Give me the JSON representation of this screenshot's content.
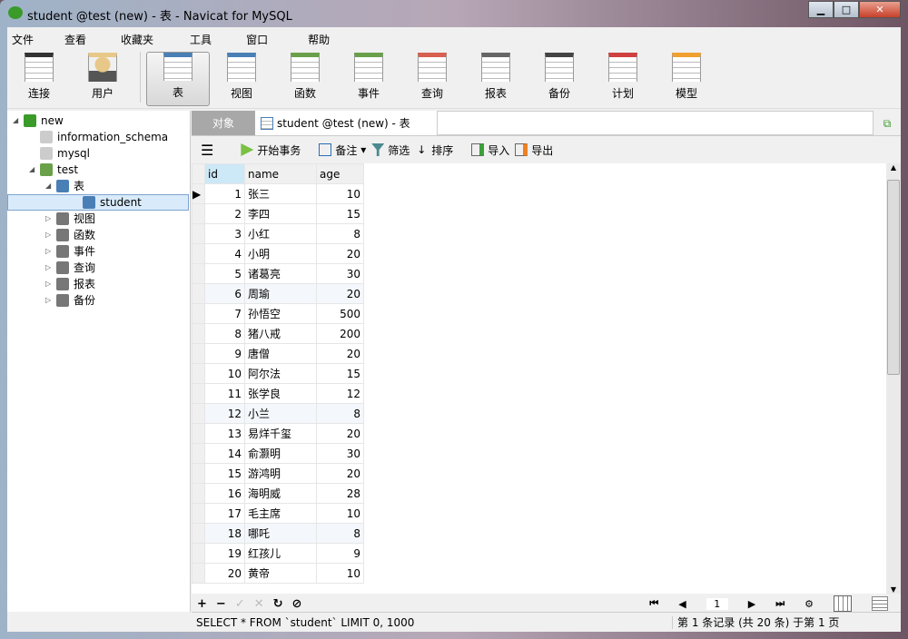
{
  "window": {
    "title": "student @test (new) - 表 - Navicat for MySQL",
    "minimize": "▁",
    "maximize": "□",
    "close": "✕"
  },
  "menu": [
    "文件",
    "查看",
    "收藏夹",
    "工具",
    "窗口",
    "帮助"
  ],
  "toolbar": [
    {
      "label": "连接",
      "icon": "connection-icon"
    },
    {
      "label": "用户",
      "icon": "user-icon"
    },
    {
      "label": "表",
      "icon": "table-icon",
      "active": true
    },
    {
      "label": "视图",
      "icon": "view-icon"
    },
    {
      "label": "函数",
      "icon": "function-icon"
    },
    {
      "label": "事件",
      "icon": "event-icon"
    },
    {
      "label": "查询",
      "icon": "query-icon"
    },
    {
      "label": "报表",
      "icon": "report-icon"
    },
    {
      "label": "备份",
      "icon": "backup-icon"
    },
    {
      "label": "计划",
      "icon": "schedule-icon"
    },
    {
      "label": "模型",
      "icon": "model-icon"
    }
  ],
  "tree": {
    "connection": "new",
    "dbs": [
      "information_schema",
      "mysql",
      "test"
    ],
    "tables_group": "表",
    "table": "student",
    "groups": [
      "视图",
      "函数",
      "事件",
      "查询",
      "报表",
      "备份"
    ]
  },
  "tabs": {
    "objects": "对象",
    "current": "student @test (new) - 表"
  },
  "table_toolbar": {
    "begin_tx": "开始事务",
    "note": "备注",
    "filter": "筛选",
    "sort": "排序",
    "import": "导入",
    "export": "导出"
  },
  "columns": [
    "id",
    "name",
    "age"
  ],
  "rows": [
    [
      1,
      "张三",
      10
    ],
    [
      2,
      "李四",
      15
    ],
    [
      3,
      "小红",
      8
    ],
    [
      4,
      "小明",
      20
    ],
    [
      5,
      "诸葛亮",
      30
    ],
    [
      6,
      "周瑜",
      20
    ],
    [
      7,
      "孙悟空",
      500
    ],
    [
      8,
      "猪八戒",
      200
    ],
    [
      9,
      "唐僧",
      20
    ],
    [
      10,
      "阿尔法",
      15
    ],
    [
      11,
      "张学良",
      12
    ],
    [
      12,
      "小兰",
      8
    ],
    [
      13,
      "易烊千玺",
      20
    ],
    [
      14,
      "俞灏明",
      30
    ],
    [
      15,
      "游鸿明",
      20
    ],
    [
      16,
      "海明威",
      28
    ],
    [
      17,
      "毛主席",
      10
    ],
    [
      18,
      "哪吒",
      8
    ],
    [
      19,
      "红孩儿",
      9
    ],
    [
      20,
      "黄帝",
      10
    ]
  ],
  "bottom": {
    "add": "+",
    "delete": "−",
    "apply": "✓",
    "cancel": "✕",
    "refresh": "↻",
    "stop": "⊘",
    "first": "⏮",
    "prev": "◀",
    "page": "1",
    "next": "▶",
    "last": "⏭",
    "settings": "⚙"
  },
  "status": {
    "sql": "SELECT * FROM `student` LIMIT 0, 1000",
    "records": "第 1 条记录 (共 20 条) 于第 1 页"
  }
}
